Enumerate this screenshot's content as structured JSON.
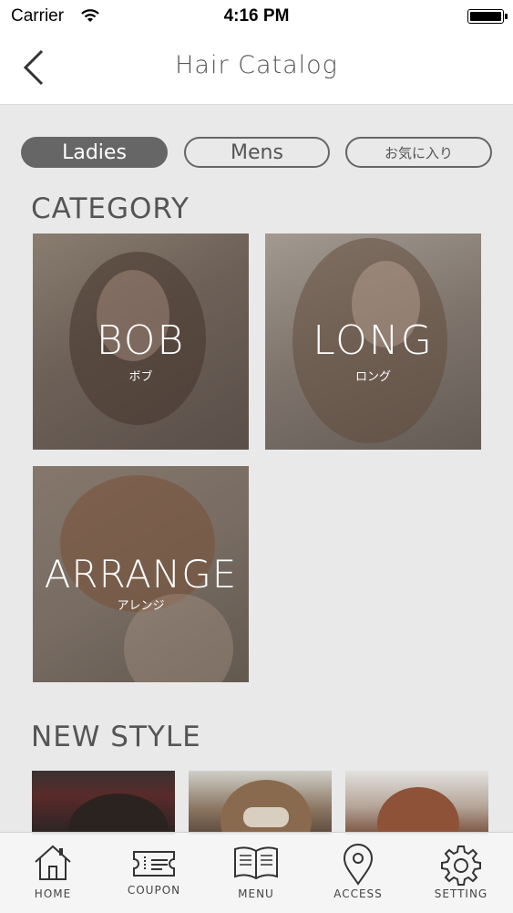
{
  "status_bar": {
    "carrier": "Carrier",
    "time": "4:16 PM"
  },
  "nav": {
    "title": "Hair Catalog"
  },
  "segments": {
    "ladies": "Ladies",
    "mens": "Mens",
    "favorites": "お気に入り"
  },
  "sections": {
    "category": "CATEGORY",
    "new_style": "NEW STYLE"
  },
  "categories": [
    {
      "title": "BOB",
      "subtitle": "ボブ"
    },
    {
      "title": "LONG",
      "subtitle": "ロング"
    },
    {
      "title": "ARRANGE",
      "subtitle": "アレンジ"
    }
  ],
  "tabs": [
    {
      "label": "HOME",
      "icon": "home-icon"
    },
    {
      "label": "COUPON",
      "icon": "coupon-icon"
    },
    {
      "label": "MENU",
      "icon": "menu-book-icon"
    },
    {
      "label": "ACCESS",
      "icon": "location-pin-icon"
    },
    {
      "label": "SETTING",
      "icon": "gear-icon"
    }
  ],
  "colors": {
    "segment_active": "#666666",
    "background": "#e9e9e9"
  }
}
